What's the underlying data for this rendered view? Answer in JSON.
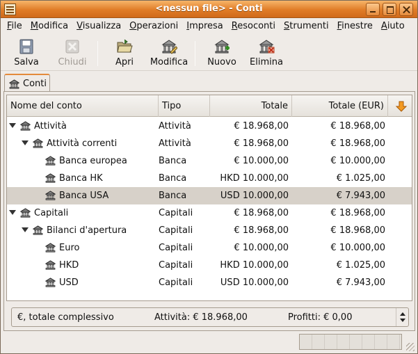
{
  "window": {
    "title": "<nessun file> - Conti"
  },
  "menu": [
    "File",
    "Modifica",
    "Visualizza",
    "Operazioni",
    "Impresa",
    "Resoconti",
    "Strumenti",
    "Finestre",
    "Aiuto"
  ],
  "toolbar": {
    "save": "Salva",
    "close": "Chiudi",
    "open": "Apri",
    "edit": "Modifica",
    "new": "Nuovo",
    "delete": "Elimina"
  },
  "tab": {
    "label": "Conti"
  },
  "columns": {
    "name": "Nome del conto",
    "type": "Tipo",
    "total": "Totale",
    "total_eur": "Totale (EUR)"
  },
  "accounts": [
    {
      "name": "Attività",
      "type": "Attività",
      "total": "€ 18.968,00",
      "total_eur": "€ 18.968,00",
      "depth": 0,
      "expander": true
    },
    {
      "name": "Attività correnti",
      "type": "Attività",
      "total": "€ 18.968,00",
      "total_eur": "€ 18.968,00",
      "depth": 1,
      "expander": true
    },
    {
      "name": "Banca europea",
      "type": "Banca",
      "total": "€ 10.000,00",
      "total_eur": "€ 10.000,00",
      "depth": 2,
      "expander": false
    },
    {
      "name": "Banca HK",
      "type": "Banca",
      "total": "HKD 10.000,00",
      "total_eur": "€ 1.025,00",
      "depth": 2,
      "expander": false
    },
    {
      "name": "Banca USA",
      "type": "Banca",
      "total": "USD 10.000,00",
      "total_eur": "€ 7.943,00",
      "depth": 2,
      "expander": false,
      "selected": true
    },
    {
      "name": "Capitali",
      "type": "Capitali",
      "total": "€ 18.968,00",
      "total_eur": "€ 18.968,00",
      "depth": 0,
      "expander": true
    },
    {
      "name": "Bilanci d'apertura",
      "type": "Capitali",
      "total": "€ 18.968,00",
      "total_eur": "€ 18.968,00",
      "depth": 1,
      "expander": true
    },
    {
      "name": "Euro",
      "type": "Capitali",
      "total": "€ 10.000,00",
      "total_eur": "€ 10.000,00",
      "depth": 2,
      "expander": false
    },
    {
      "name": "HKD",
      "type": "Capitali",
      "total": "HKD 10.000,00",
      "total_eur": "€ 1.025,00",
      "depth": 2,
      "expander": false
    },
    {
      "name": "USD",
      "type": "Capitali",
      "total": "USD 10.000,00",
      "total_eur": "€ 7.943,00",
      "depth": 2,
      "expander": false
    }
  ],
  "summary": {
    "label": "€, totale complessivo",
    "assets": "Attività: € 18.968,00",
    "profits": "Profitti: € 0,00"
  },
  "colors": {
    "titlebar": "#e07c27",
    "selected_row": "#d7d1c9",
    "accent": "#e48a3a"
  }
}
